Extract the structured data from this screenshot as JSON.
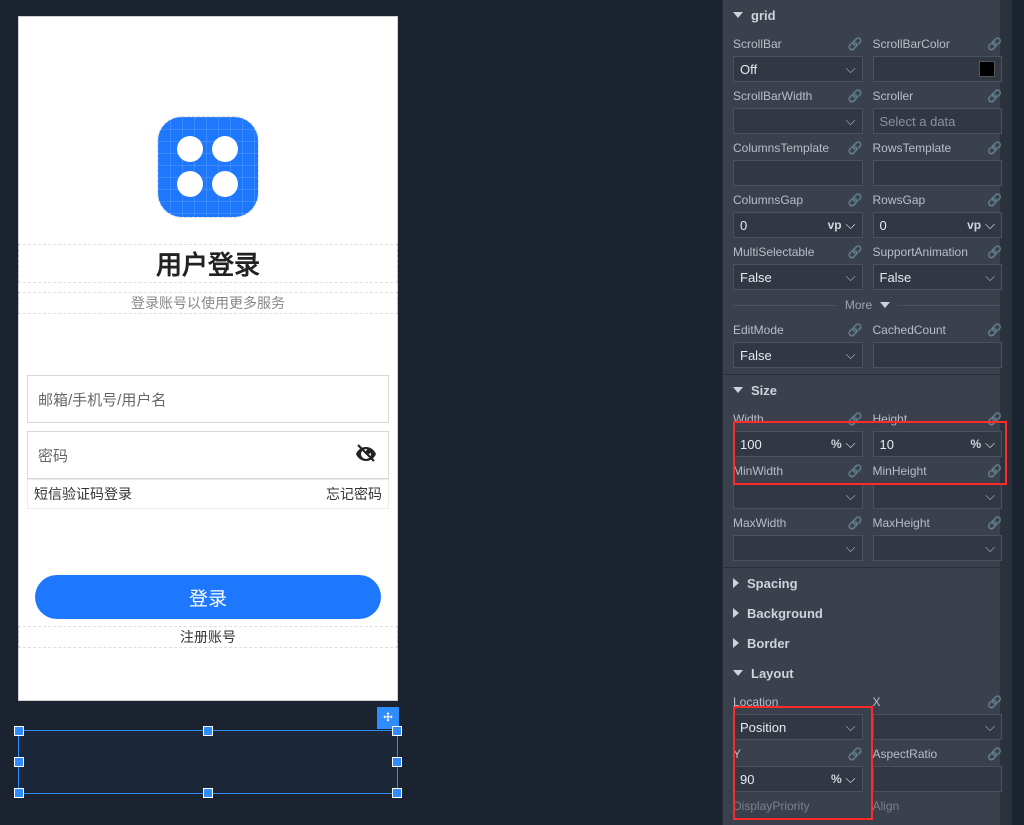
{
  "canvas": {
    "app_icon_name": "app-logo",
    "title": "用户登录",
    "subtitle": "登录账号以使用更多服务",
    "email_placeholder": "邮箱/手机号/用户名",
    "password_placeholder": "密码",
    "sms_login": "短信验证码登录",
    "forgot": "忘记密码",
    "login_button": "登录",
    "register": "注册账号"
  },
  "inspector": {
    "section_grid": "grid",
    "grid": {
      "scrollbar_label": "ScrollBar",
      "scrollbar_value": "Off",
      "scrollbarcolor_label": "ScrollBarColor",
      "scrollbarwidth_label": "ScrollBarWidth",
      "scroller_label": "Scroller",
      "scroller_placeholder": "Select a data",
      "colstpl_label": "ColumnsTemplate",
      "rowstpl_label": "RowsTemplate",
      "colsgap_label": "ColumnsGap",
      "colsgap_value": "0",
      "colsgap_unit": "vp",
      "rowsgap_label": "RowsGap",
      "rowsgap_value": "0",
      "rowsgap_unit": "vp",
      "multisel_label": "MultiSelectable",
      "multisel_value": "False",
      "supanim_label": "SupportAnimation",
      "supanim_value": "False",
      "more": "More",
      "editmode_label": "EditMode",
      "editmode_value": "False",
      "cachedcount_label": "CachedCount"
    },
    "section_size": "Size",
    "size": {
      "width_label": "Width",
      "width_value": "100",
      "width_unit": "%",
      "height_label": "Height",
      "height_value": "10",
      "height_unit": "%",
      "minwidth_label": "MinWidth",
      "minheight_label": "MinHeight",
      "maxwidth_label": "MaxWidth",
      "maxheight_label": "MaxHeight"
    },
    "section_spacing": "Spacing",
    "section_background": "Background",
    "section_border": "Border",
    "section_layout": "Layout",
    "layout": {
      "location_label": "Location",
      "location_value": "Position",
      "x_label": "X",
      "y_label": "Y",
      "y_value": "90",
      "y_unit": "%",
      "aspect_label": "AspectRatio",
      "dispprio_label": "DisplayPriority",
      "align_label": "Align"
    }
  }
}
